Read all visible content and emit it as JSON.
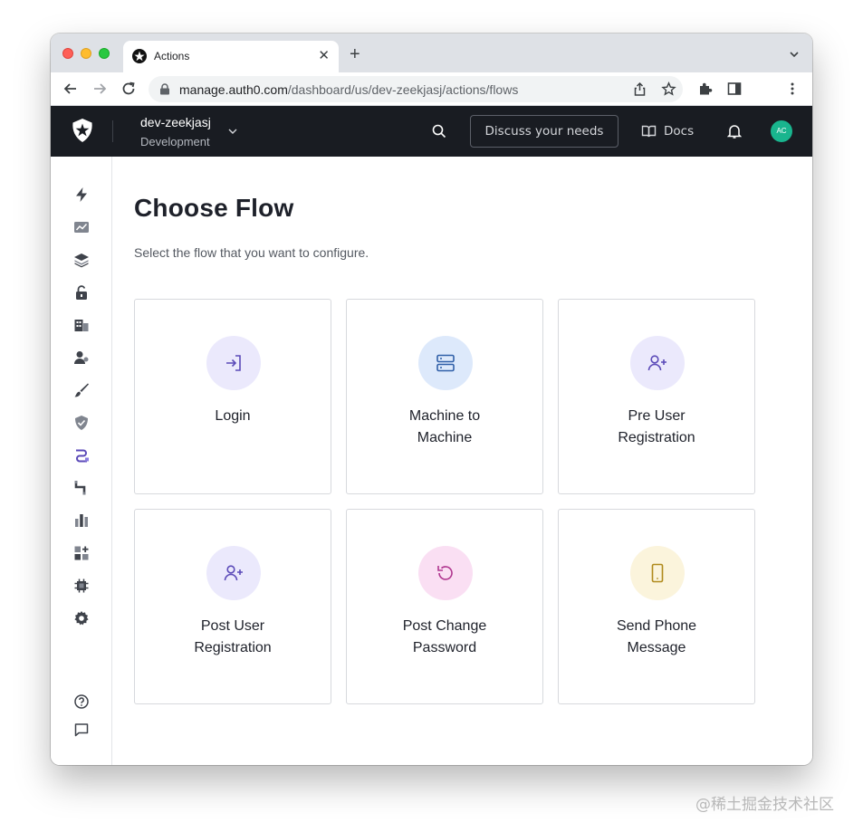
{
  "browser": {
    "tab_title": "Actions",
    "url_host": "manage.auth0.com",
    "url_path": "/dashboard/us/dev-zeekjasj/actions/flows"
  },
  "header": {
    "tenant_name": "dev-zeekjasj",
    "tenant_env": "Development",
    "discuss_label": "Discuss your needs",
    "docs_label": "Docs",
    "avatar_initials": "AC"
  },
  "sidebar": {
    "icons": [
      "bolt-icon",
      "activity-icon",
      "layers-icon",
      "lock-icon",
      "organizations-icon",
      "user-management-icon",
      "branding-icon",
      "security-icon",
      "actions-icon",
      "pipeline-icon",
      "monitoring-icon",
      "marketplace-icon",
      "extensions-icon",
      "settings-icon",
      "help-icon",
      "feedback-icon"
    ]
  },
  "main": {
    "title": "Choose Flow",
    "subtitle": "Select the flow that you want to configure.",
    "cards": [
      {
        "label": "Login",
        "icon": "login-icon",
        "bg": "#ebe9fc",
        "fg": "#5b4ab8"
      },
      {
        "label": "Machine to\nMachine",
        "icon": "server-icon",
        "bg": "#dde9fb",
        "fg": "#2f5fa8"
      },
      {
        "label": "Pre User\nRegistration",
        "icon": "user-plus-icon",
        "bg": "#ebe9fc",
        "fg": "#5b4ab8"
      },
      {
        "label": "Post User\nRegistration",
        "icon": "user-plus-icon",
        "bg": "#ebe9fc",
        "fg": "#5b4ab8"
      },
      {
        "label": "Post Change\nPassword",
        "icon": "rotate-icon",
        "bg": "#fadff3",
        "fg": "#b0368f"
      },
      {
        "label": "Send Phone\nMessage",
        "icon": "phone-icon",
        "bg": "#fbf4dc",
        "fg": "#b08a1c"
      }
    ]
  },
  "watermark": "@稀土掘金技术社区"
}
